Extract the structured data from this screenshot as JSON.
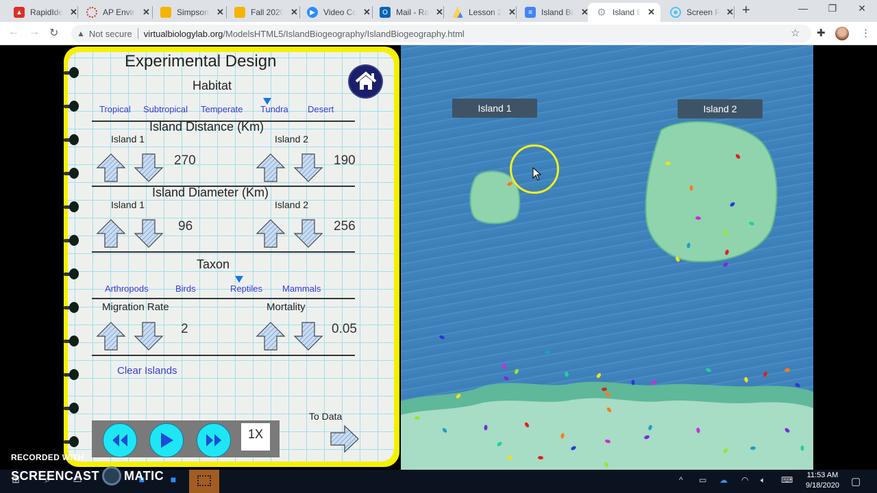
{
  "browser": {
    "tabs": [
      {
        "title": "RapidIdentity",
        "favicon": "rapididentity-icon",
        "color": "#d93025"
      },
      {
        "title": "AP Environmental",
        "favicon": "ap-icon",
        "color": "#d93025"
      },
      {
        "title": "Simpson",
        "favicon": "slides-icon",
        "color": "#f4b400"
      },
      {
        "title": "Fall 2020",
        "favicon": "slides-icon",
        "color": "#f4b400"
      },
      {
        "title": "Video Conference",
        "favicon": "zoom-icon",
        "color": "#2d8cff"
      },
      {
        "title": "Mail - Ra",
        "favicon": "outlook-icon",
        "color": "#0364b8"
      },
      {
        "title": "Lesson 2",
        "favicon": "drive-icon",
        "color": "#1fa463"
      },
      {
        "title": "Island Biogeography",
        "favicon": "docs-icon",
        "color": "#4285f4"
      },
      {
        "title": "Island Biogeography",
        "favicon": "gear-icon",
        "color": "#9aa0a6",
        "active": true
      },
      {
        "title": "Screen Recorder",
        "favicon": "screencast-icon",
        "color": "#4fc3f7"
      }
    ],
    "security_label": "Not secure",
    "url_domain": "virtualbiologylab.org",
    "url_path": "/ModelsHTML5/IslandBiogeography/IslandBiogeography.html"
  },
  "panel": {
    "title": "Experimental Design",
    "habitat": {
      "heading": "Habitat",
      "options": [
        "Tropical",
        "Subtropical",
        "Temperate",
        "Tundra",
        "Desert"
      ],
      "selected": "Tundra"
    },
    "distance": {
      "heading": "Island Distance (Km)",
      "island1_label": "Island 1",
      "island2_label": "Island 2",
      "island1_value": "270",
      "island2_value": "190"
    },
    "diameter": {
      "heading": "Island Diameter (Km)",
      "island1_label": "Island 1",
      "island2_label": "Island 2",
      "island1_value": "96",
      "island2_value": "256"
    },
    "taxon": {
      "heading": "Taxon",
      "options": [
        "Arthropods",
        "Birds",
        "Reptiles",
        "Mammals"
      ],
      "selected": "Reptiles"
    },
    "migration": {
      "label": "Migration Rate",
      "value": "2"
    },
    "mortality": {
      "label": "Mortality",
      "value": "0.05"
    },
    "clear_label": "Clear Islands",
    "to_data_label": "To Data",
    "speed_label": "1X"
  },
  "map": {
    "island1_label": "Island 1",
    "island2_label": "Island 2"
  },
  "overlay": {
    "watermark_small": "RECORDED WITH",
    "watermark_left": "SCREENCAST",
    "watermark_right": "MATIC"
  },
  "taskbar": {
    "time": "11:53 AM",
    "date": "9/18/2020"
  }
}
